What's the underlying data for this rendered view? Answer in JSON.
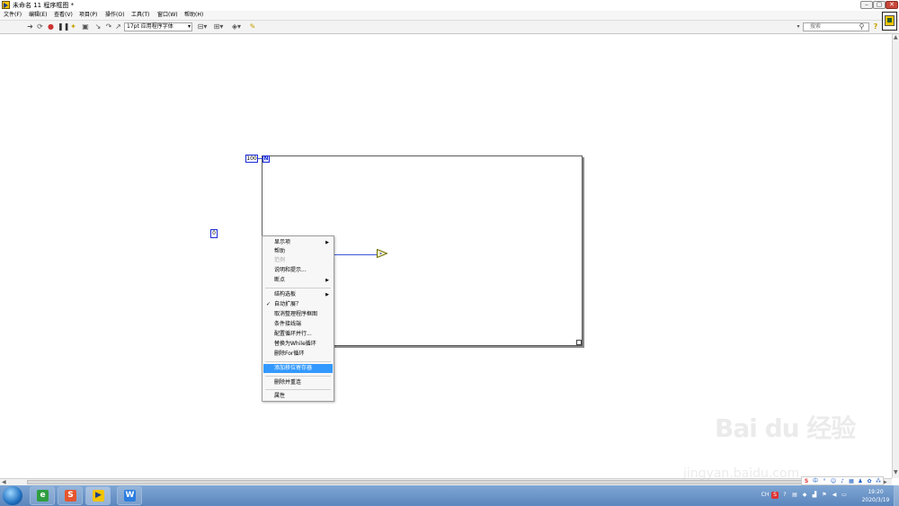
{
  "window": {
    "title": "未命名 11 程序框图 *",
    "controls": {
      "minimize": "–",
      "maximize": "▢",
      "close": "✕"
    }
  },
  "menubar": {
    "items": [
      "文件(F)",
      "编辑(E)",
      "查看(V)",
      "项目(P)",
      "操作(O)",
      "工具(T)",
      "窗口(W)",
      "帮助(H)"
    ]
  },
  "toolbar": {
    "icons": [
      "run-arrow-icon",
      "run-continuously-icon",
      "abort-icon",
      "pause-icon",
      "highlight-execution-icon",
      "retain-wire-values-icon",
      "step-into-icon",
      "step-over-icon",
      "step-out-icon",
      "text-settings-icon",
      "align-icon",
      "distribute-icon",
      "reorder-icon",
      "clean-up-icon"
    ],
    "font_label": "17pt 应用程序字体",
    "search_placeholder": "搜索"
  },
  "diagram": {
    "loop_count": "100",
    "count_terminal": "N",
    "constant_zero": "0"
  },
  "context_menu": {
    "items": [
      {
        "label": "显示项",
        "submenu": true
      },
      {
        "label": "帮助"
      },
      {
        "label": "范例",
        "disabled": true
      },
      {
        "label": "说明和提示..."
      },
      {
        "label": "断点",
        "submenu": true
      },
      {
        "label": "结构选板",
        "submenu": true
      },
      {
        "label": "自动扩展？",
        "checked": true
      },
      {
        "label": "取消整理程序框图"
      },
      {
        "label": "条件接线端"
      },
      {
        "label": "配置循环并行..."
      },
      {
        "label": "替换为While循环"
      },
      {
        "label": "删除For循环"
      },
      {
        "label": "添加移位寄存器",
        "selected": true
      },
      {
        "label": "删除并重连"
      },
      {
        "label": "属性"
      }
    ],
    "submenu_glyph": "▶",
    "check_glyph": "✓"
  },
  "taskbar": {
    "apps": [
      "ie-icon",
      "sogou-icon",
      "labview-icon",
      "wps-icon"
    ],
    "tray_lang": "CH",
    "clock_time": "19:20",
    "clock_date": "2020/3/19",
    "ime_label": "中"
  },
  "watermark": {
    "logo": "Bai du 经验",
    "url": "jingyan.baidu.com"
  },
  "colors": {
    "selection": "#3399ff",
    "wire": "#3a56d8",
    "terminal_border": "#1a2bd6",
    "taskbar": "#5b86bd"
  }
}
